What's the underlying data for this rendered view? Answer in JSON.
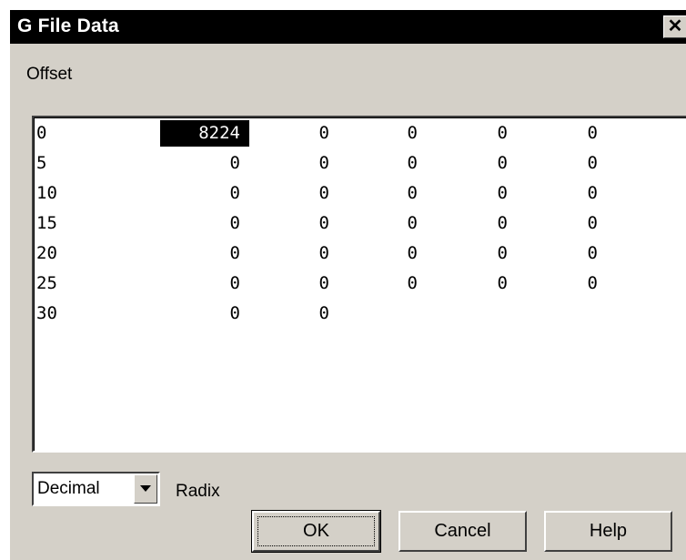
{
  "window": {
    "title": "G File Data",
    "close_glyph": "✕"
  },
  "offset_label": "Offset",
  "grid": {
    "rows": [
      {
        "offset": "0",
        "values": [
          "8224",
          "0",
          "0",
          "0",
          "0"
        ]
      },
      {
        "offset": "5",
        "values": [
          "0",
          "0",
          "0",
          "0",
          "0"
        ]
      },
      {
        "offset": "10",
        "values": [
          "0",
          "0",
          "0",
          "0",
          "0"
        ]
      },
      {
        "offset": "15",
        "values": [
          "0",
          "0",
          "0",
          "0",
          "0"
        ]
      },
      {
        "offset": "20",
        "values": [
          "0",
          "0",
          "0",
          "0",
          "0"
        ]
      },
      {
        "offset": "25",
        "values": [
          "0",
          "0",
          "0",
          "0",
          "0"
        ]
      },
      {
        "offset": "30",
        "values": [
          "0",
          "0"
        ]
      }
    ],
    "selected": {
      "row": 0,
      "col": 0
    }
  },
  "radix": {
    "value": "Decimal",
    "label": "Radix"
  },
  "buttons": {
    "ok": "OK",
    "cancel": "Cancel",
    "help": "Help"
  },
  "colors": {
    "titlebar": "#000000",
    "dialog_face": "#d4d0c8",
    "selection": "#000000"
  }
}
